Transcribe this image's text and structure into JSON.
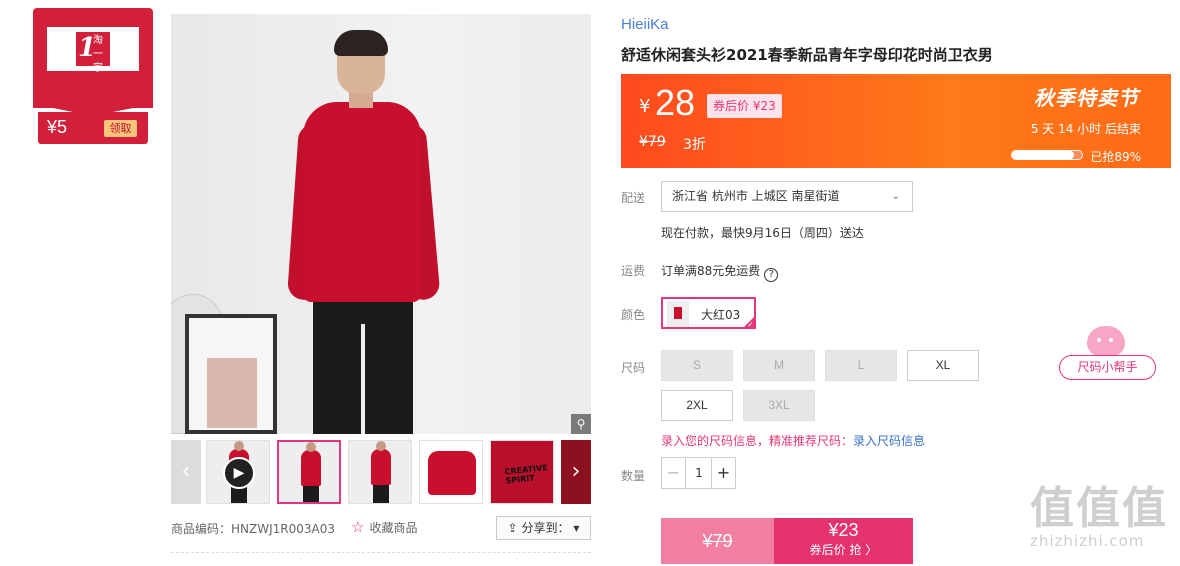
{
  "coupon": {
    "amount": "¥5",
    "claim_label": "领取",
    "logo_chars": "淘一家"
  },
  "gallery": {
    "zoom_icon": "magnifier-icon",
    "thumbnail_text": "CREATIVE SPIRIT"
  },
  "product_meta": {
    "sku": "商品编码：HNZWJ1R003A03",
    "favorite_label": "收藏商品",
    "share_label": "分享到："
  },
  "product": {
    "brand": "HieiiKa",
    "title": "舒适休闲套头衫2021春季新品青年字母印花时尚卫衣男"
  },
  "price": {
    "currency": "¥",
    "current": "28",
    "after_coupon": "券后价 ¥23",
    "original": "¥79",
    "discount": "3折",
    "sale_title": "秋季特卖节",
    "countdown": "5  天  14  小时  后结束",
    "sold_percent": 89,
    "sold_text": "已抢89%"
  },
  "delivery": {
    "label": "配送",
    "address": "浙江省  杭州市  上城区  南星街道",
    "eta": "现在付款，最快9月16日（周四）送达"
  },
  "freight": {
    "label": "运费",
    "text": "订单满88元免运费"
  },
  "color": {
    "label": "颜色",
    "selected": "大红03"
  },
  "size": {
    "label": "尺码",
    "options": [
      "S",
      "M",
      "L",
      "XL",
      "2XL",
      "3XL"
    ],
    "tip_prefix": "录入您的尺码信息，精准推荐尺码：",
    "tip_link": "录入尺码信息",
    "helper_label": "尺码小帮手"
  },
  "quantity": {
    "label": "数量",
    "minus": "−",
    "value": "1",
    "plus": "+"
  },
  "buttons": {
    "original": "¥79",
    "buy_price": "¥23",
    "buy_label": "券后价 抢 〉"
  },
  "watermark": {
    "big": "值值值",
    "small": "zhizhizhi.com"
  },
  "colors": {
    "accent": "#e4367a",
    "sale_orange": "#ff5a1e",
    "coupon_red": "#d3203a",
    "link_blue": "#4a7fd1"
  }
}
